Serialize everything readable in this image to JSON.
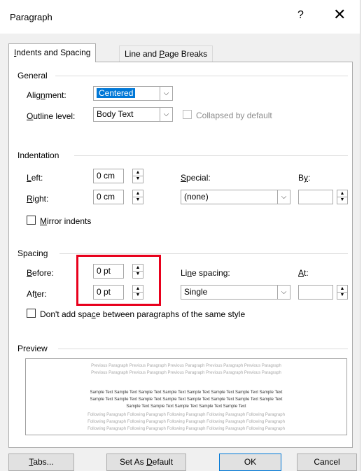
{
  "title": "Paragraph",
  "help_glyph": "?",
  "close_glyph": "✕",
  "tabs": [
    {
      "label": "Indents and Spacing",
      "mnemonic": "I"
    },
    {
      "label": "Line and Page Breaks",
      "mnemonic": "P"
    }
  ],
  "general": {
    "heading": "General",
    "alignment_label": "Alignment:",
    "alignment_value": "Centered",
    "outline_label": "Outline level:",
    "outline_value": "Body Text",
    "collapsed_label": "Collapsed by default"
  },
  "indentation": {
    "heading": "Indentation",
    "left_label": "Left:",
    "left_value": "0 cm",
    "right_label": "Right:",
    "right_value": "0 cm",
    "special_label": "Special:",
    "special_value": "(none)",
    "by_label": "By:",
    "by_value": "",
    "mirror_label": "Mirror indents"
  },
  "spacing": {
    "heading": "Spacing",
    "before_label": "Before:",
    "before_value": "0 pt",
    "after_label": "After:",
    "after_value": "0 pt",
    "line_spacing_label": "Line spacing:",
    "line_spacing_value": "Single",
    "at_label": "At:",
    "at_value": "",
    "dont_add_label": "Don't add space between paragraphs of the same style"
  },
  "preview": {
    "heading": "Preview",
    "previous_line": "Previous Paragraph Previous Paragraph Previous Paragraph Previous Paragraph Previous Paragraph",
    "sample_line": "Sample Text Sample Text Sample Text Sample Text Sample Text Sample Text Sample Text Sample Text",
    "sample_short": "Sample Text Sample Text Sample Text Sample Text Sample Text",
    "following_line": "Following Paragraph Following Paragraph Following Paragraph Following Paragraph Following Paragraph"
  },
  "buttons": {
    "tabs": "Tabs...",
    "set_default": "Set As Default",
    "ok": "OK",
    "cancel": "Cancel"
  },
  "colors": {
    "highlight": "#e8001c",
    "selection": "#0078d7"
  }
}
